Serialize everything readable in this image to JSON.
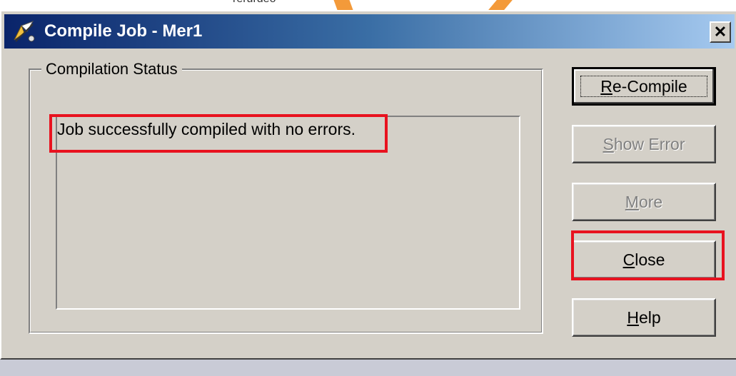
{
  "background": {
    "partial_text": "rerurdeo"
  },
  "window": {
    "title": "Compile Job - Mer1",
    "close_glyph": "✕",
    "icon": "compile-job-icon"
  },
  "group": {
    "label": "Compilation Status"
  },
  "status": {
    "message": "Job successfully compiled with no errors."
  },
  "buttons": {
    "recompile": {
      "pre": "",
      "key": "R",
      "post": "e-Compile",
      "enabled": true
    },
    "show_error": {
      "pre": "",
      "key": "S",
      "post": "how Error",
      "enabled": false
    },
    "more": {
      "pre": "",
      "key": "M",
      "post": "ore",
      "enabled": false
    },
    "close": {
      "pre": "",
      "key": "C",
      "post": "lose",
      "enabled": true
    },
    "help": {
      "pre": "",
      "key": "H",
      "post": "elp",
      "enabled": true
    }
  },
  "colors": {
    "dialog_face": "#d4d0c8",
    "titlebar_start": "#0a246a",
    "titlebar_end": "#a6caf0",
    "annotation_red": "#e8121f",
    "annotation_orange": "#f39a3a"
  }
}
